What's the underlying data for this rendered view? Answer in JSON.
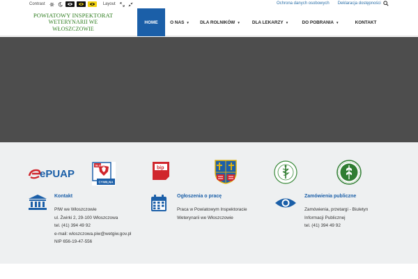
{
  "topbar": {
    "contrast_label": "Contrast",
    "layout_label": "Layout",
    "links": [
      "Ochrona danych osobowych",
      "Deklaracja dostępności"
    ],
    "icons": [
      "sun-icon",
      "moon-icon",
      "eye-icon",
      "eye-icon",
      "eye-icon",
      "expand-icon",
      "collapse-icon",
      "search-icon"
    ],
    "colors": {
      "link": "#2a6fa8",
      "highlight": "#f2d20c"
    }
  },
  "header": {
    "logo_line1": "POWIATOWY INSPEKTORAT",
    "logo_line2": "WETERYNARII WE WŁOSZCZOWIE",
    "logo_color": "#2e7d1f"
  },
  "nav": {
    "items": [
      {
        "label": "HOME",
        "active": true,
        "dropdown": false
      },
      {
        "label": "O NAS",
        "active": false,
        "dropdown": true
      },
      {
        "label": "DLA ROLNIKÓW",
        "active": false,
        "dropdown": true
      },
      {
        "label": "DLA LEKARZY",
        "active": false,
        "dropdown": true
      },
      {
        "label": "DO POBRANIA",
        "active": false,
        "dropdown": true
      },
      {
        "label": "KONTAKT",
        "active": false,
        "dropdown": false
      }
    ],
    "active_color": "#1b5fa8"
  },
  "hero": {
    "color": "#4d4d4d"
  },
  "partner_logos": {
    "epuap_text": "ePUAP",
    "sluzba_line1": "SŁUŻBA",
    "sluzba_line2": "CYWILNA",
    "bip_text": "bip"
  },
  "footer": {
    "contact": {
      "title": "Kontakt",
      "icon": "institution-icon",
      "lines": [
        "PIW we Włoszczowie",
        "ul. Żwirki 2, 29-100 Włoszczowa",
        "tel. (41) 394 49 92",
        "e-mail: wloszczowa.piw@wetgiw.gov.pl",
        "NIP 656-19-47-556"
      ]
    },
    "jobs": {
      "title": "Ogłoszenia o pracę",
      "icon": "calendar-icon",
      "lines": [
        "Praca w Powiatowym Inspektoracie",
        "Weterynarii we Włoszczowie"
      ]
    },
    "tenders": {
      "title": "Zamówienia publiczne",
      "icon": "eye-icon",
      "lines": [
        "Zamówienia, przetargi - Biuletyn",
        "Informacji Publicznej",
        "tel. (41) 394 49 92"
      ]
    },
    "accent": "#1b5fa8"
  }
}
